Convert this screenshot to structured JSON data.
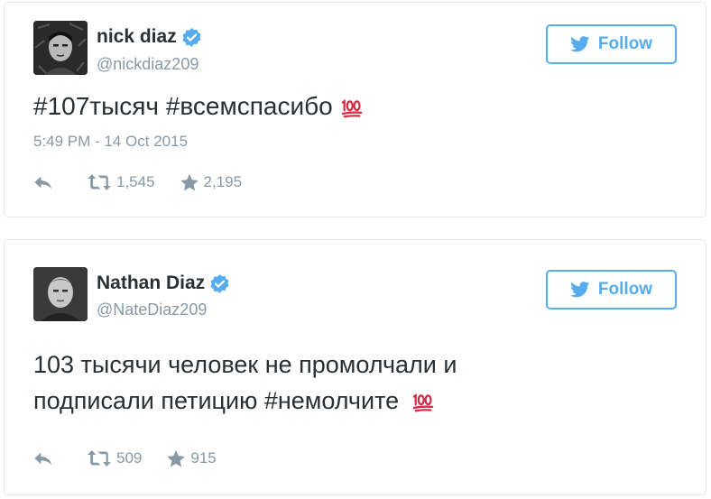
{
  "tweets": [
    {
      "display_name": "nick diaz",
      "handle": "@nickdiaz209",
      "follow_label": "Follow",
      "text": "#107тысяч #всемспасибо",
      "emoji": "100-emoji",
      "timestamp": "5:49 PM - 14 Oct 2015",
      "retweets": "1,545",
      "favorites": "2,195"
    },
    {
      "display_name": "Nathan Diaz",
      "handle": "@NateDiaz209",
      "follow_label": "Follow",
      "text_line1": "103 тысячи человек не промолчали и",
      "text_line2": "подписали петицию #немолчите",
      "emoji": "100-emoji",
      "retweets": "509",
      "favorites": "915"
    }
  ],
  "colors": {
    "twitter_blue": "#55acee",
    "muted_gray": "#8899a6",
    "text_dark": "#292f33",
    "emoji_red": "#d42a43",
    "card_border": "#e1e8ed"
  },
  "icons": [
    "verified-badge-icon",
    "twitter-bird-icon",
    "reply-icon",
    "retweet-icon",
    "star-icon",
    "hundred-points-emoji"
  ]
}
